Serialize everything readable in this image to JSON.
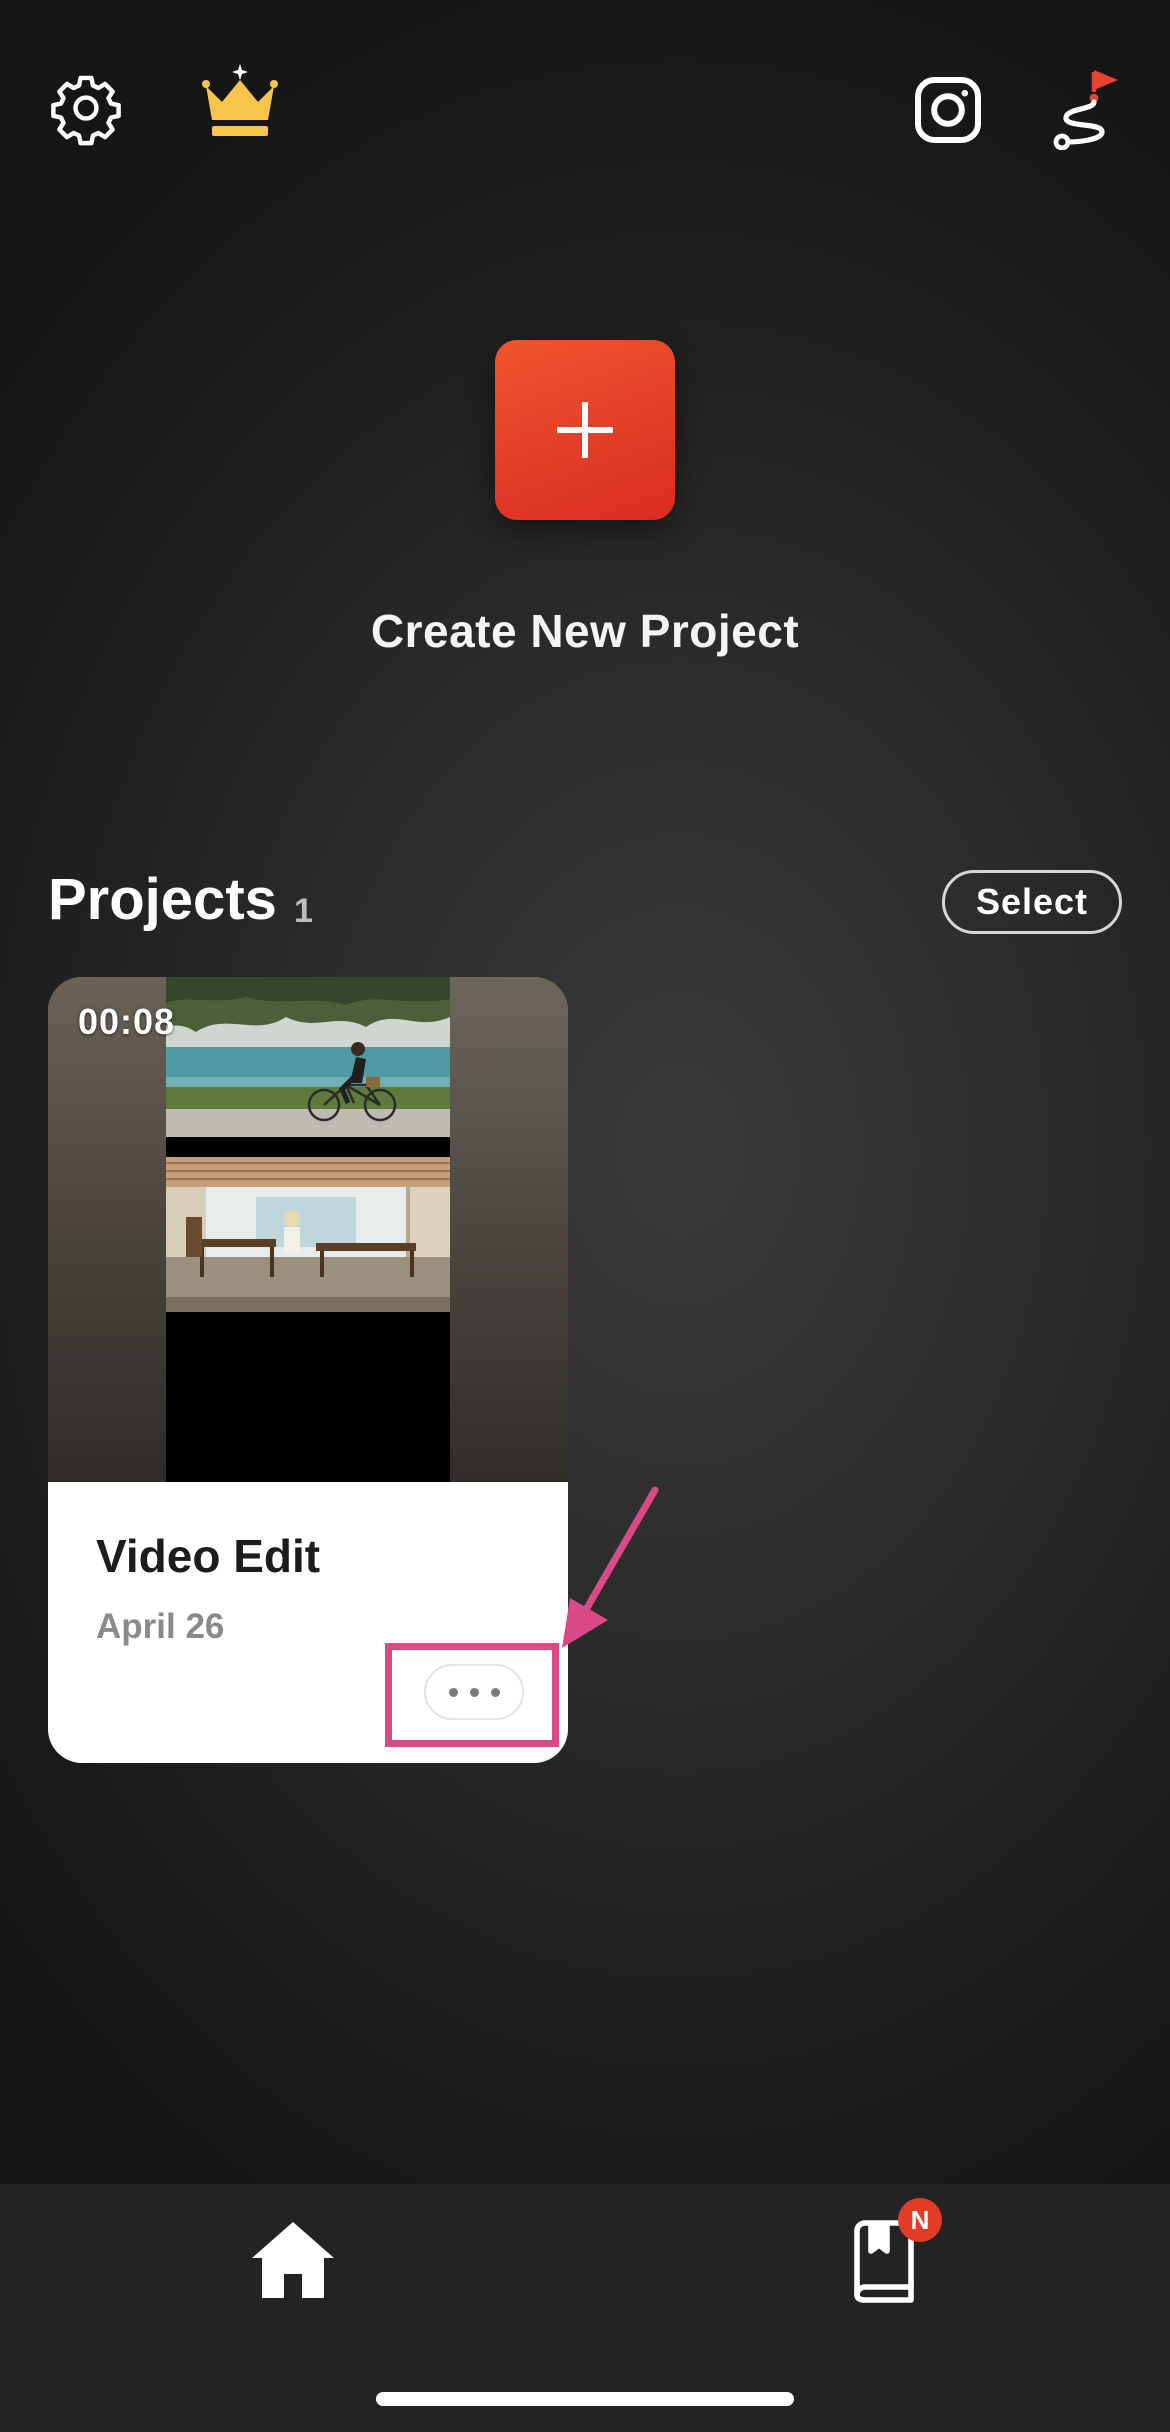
{
  "top_bar": {
    "icons": [
      "gear-icon",
      "crown-icon",
      "instagram-icon",
      "tutorial-path-icon"
    ],
    "accent_crown_color": "#f6c54a",
    "accent_flag_color": "#e8432c"
  },
  "create": {
    "button_icon": "plus-icon",
    "label": "Create New Project",
    "button_color": "#e2402a"
  },
  "projects": {
    "title": "Projects",
    "count": "1",
    "select_label": "Select",
    "items": [
      {
        "duration": "00:08",
        "title": "Video Edit",
        "date": "April 26",
        "more_icon": "more-dots-icon"
      }
    ]
  },
  "annotation": {
    "color": "#d94a86"
  },
  "bottom_nav": {
    "tabs": [
      {
        "icon": "home-icon",
        "active": true
      },
      {
        "icon": "book-icon",
        "badge": "N"
      }
    ]
  }
}
